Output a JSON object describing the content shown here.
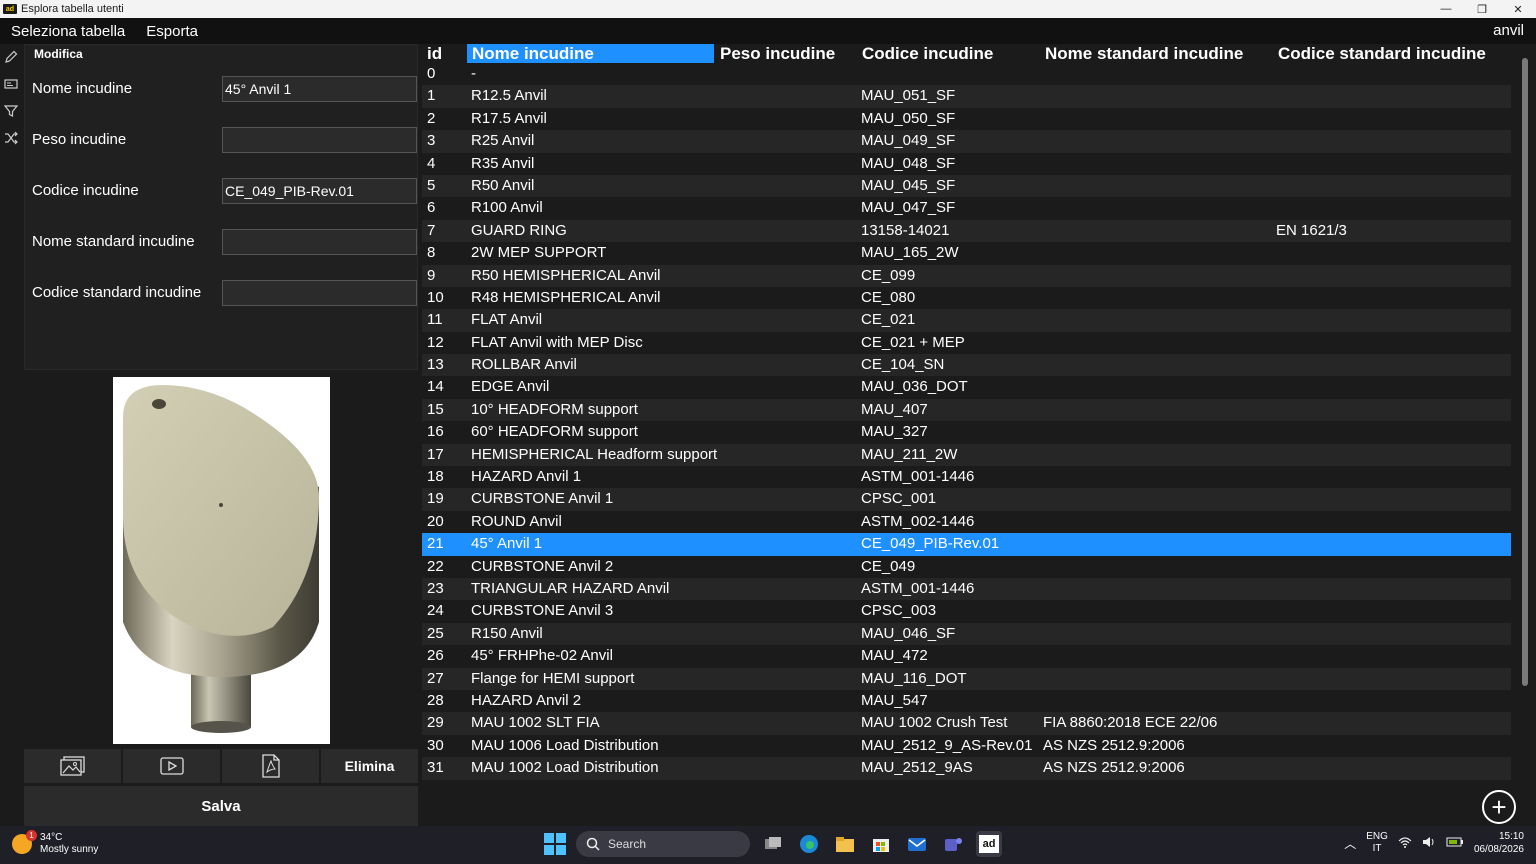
{
  "window": {
    "title": "Esplora tabella utenti",
    "logo_text": "ad",
    "controls": [
      "—",
      "❐",
      "✕"
    ]
  },
  "menu": {
    "items": [
      "Seleziona tabella",
      "Esporta"
    ],
    "current_table": "anvil"
  },
  "form": {
    "title": "Modifica",
    "fields": [
      {
        "label": "Nome incudine",
        "value": "45° Anvil 1"
      },
      {
        "label": "Peso incudine",
        "value": ""
      },
      {
        "label": "Codice incudine",
        "value": "CE_049_PIB-Rev.01"
      },
      {
        "label": "Nome standard incudine",
        "value": ""
      },
      {
        "label": "Codice standard incudine",
        "value": ""
      }
    ]
  },
  "actions": {
    "delete_label": "Elimina",
    "save_label": "Salva"
  },
  "table": {
    "columns": [
      "id",
      "Nome incudine",
      "Peso incudine",
      "Codice incudine",
      "Nome standard incudine",
      "Codice standard incudine"
    ],
    "selected_id": "21",
    "rows": [
      [
        "0",
        "-",
        "",
        "",
        "",
        ""
      ],
      [
        "1",
        "R12.5 Anvil",
        "",
        "MAU_051_SF",
        "",
        ""
      ],
      [
        "2",
        "R17.5 Anvil",
        "",
        "MAU_050_SF",
        "",
        ""
      ],
      [
        "3",
        "R25 Anvil",
        "",
        "MAU_049_SF",
        "",
        ""
      ],
      [
        "4",
        "R35 Anvil",
        "",
        "MAU_048_SF",
        "",
        ""
      ],
      [
        "5",
        "R50 Anvil",
        "",
        "MAU_045_SF",
        "",
        ""
      ],
      [
        "6",
        "R100 Anvil",
        "",
        "MAU_047_SF",
        "",
        ""
      ],
      [
        "7",
        "GUARD RING",
        "",
        "13158-14021",
        "",
        "EN 1621/3"
      ],
      [
        "8",
        "2W MEP SUPPORT",
        "",
        "MAU_165_2W",
        "",
        ""
      ],
      [
        "9",
        "R50 HEMISPHERICAL Anvil",
        "",
        "CE_099",
        "",
        ""
      ],
      [
        "10",
        "R48 HEMISPHERICAL Anvil",
        "",
        "CE_080",
        "",
        ""
      ],
      [
        "11",
        "FLAT Anvil",
        "",
        "CE_021",
        "",
        ""
      ],
      [
        "12",
        "FLAT Anvil with MEP Disc",
        "",
        "CE_021 + MEP",
        "",
        ""
      ],
      [
        "13",
        "ROLLBAR Anvil",
        "",
        "CE_104_SN",
        "",
        ""
      ],
      [
        "14",
        "EDGE Anvil",
        "",
        "MAU_036_DOT",
        "",
        ""
      ],
      [
        "15",
        "10° HEADFORM support",
        "",
        "MAU_407",
        "",
        ""
      ],
      [
        "16",
        "60° HEADFORM support",
        "",
        "MAU_327",
        "",
        ""
      ],
      [
        "17",
        "HEMISPHERICAL Headform support",
        "",
        "MAU_211_2W",
        "",
        ""
      ],
      [
        "18",
        "HAZARD Anvil 1",
        "",
        "ASTM_001-1446",
        "",
        ""
      ],
      [
        "19",
        "CURBSTONE Anvil 1",
        "",
        "CPSC_001",
        "",
        ""
      ],
      [
        "20",
        "ROUND Anvil",
        "",
        "ASTM_002-1446",
        "",
        ""
      ],
      [
        "21",
        "45° Anvil 1",
        "",
        "CE_049_PIB-Rev.01",
        "",
        ""
      ],
      [
        "22",
        "CURBSTONE Anvil 2",
        "",
        "CE_049",
        "",
        ""
      ],
      [
        "23",
        "TRIANGULAR HAZARD Anvil",
        "",
        "ASTM_001-1446",
        "",
        ""
      ],
      [
        "24",
        "CURBSTONE Anvil 3",
        "",
        "CPSC_003",
        "",
        ""
      ],
      [
        "25",
        "R150 Anvil",
        "",
        "MAU_046_SF",
        "",
        ""
      ],
      [
        "26",
        "45° FRHPhe-02 Anvil",
        "",
        "MAU_472",
        "",
        ""
      ],
      [
        "27",
        "Flange for HEMI support",
        "",
        "MAU_116_DOT",
        "",
        ""
      ],
      [
        "28",
        "HAZARD Anvil 2",
        "",
        "MAU_547",
        "",
        ""
      ],
      [
        "29",
        "MAU 1002 SLT FIA",
        "",
        "MAU 1002 Crush Test",
        "FIA 8860:2018 ECE 22/06",
        ""
      ],
      [
        "30",
        "MAU 1006 Load Distribution",
        "",
        "MAU_2512_9_AS-Rev.01",
        "AS NZS 2512.9:2006",
        ""
      ],
      [
        "31",
        "MAU 1002 Load Distribution",
        "",
        "MAU_2512_9AS",
        "AS NZS 2512.9:2006",
        ""
      ]
    ]
  },
  "taskbar": {
    "weather_temp": "34°C",
    "weather_desc": "Mostly sunny",
    "weather_badge": "1",
    "search_placeholder": "Search",
    "lang_1": "ENG",
    "lang_2": "IT",
    "time": "15:10",
    "date": "06/08/2026"
  }
}
